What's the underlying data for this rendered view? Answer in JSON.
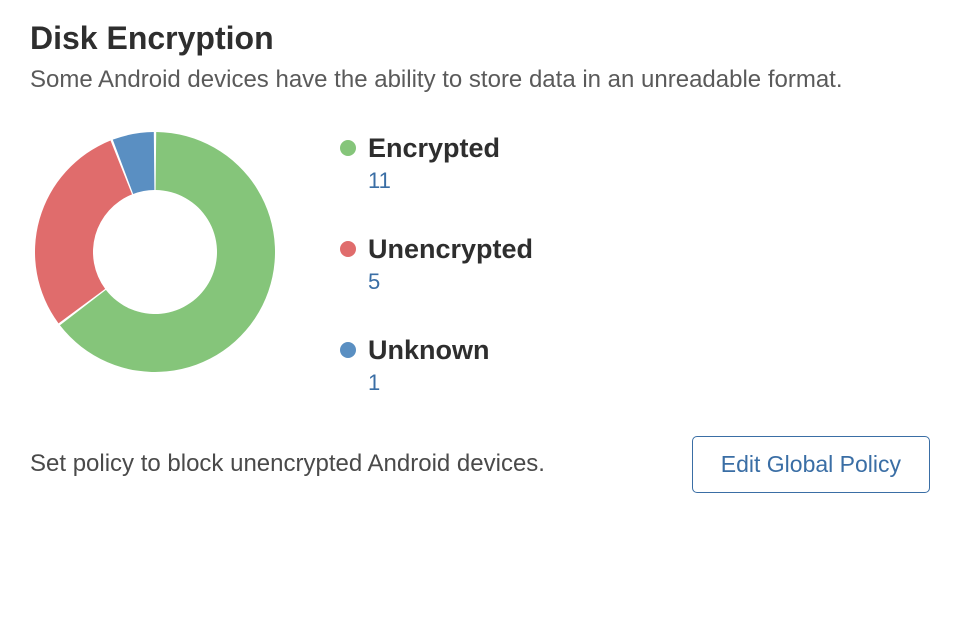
{
  "title": "Disk Encryption",
  "subtitle": "Some Android devices have the ability to store data in an unreadable format.",
  "legend": {
    "encrypted": {
      "label": "Encrypted",
      "value": "11",
      "color": "#85c57a"
    },
    "unencrypted": {
      "label": "Unencrypted",
      "value": "5",
      "color": "#e06c6c"
    },
    "unknown": {
      "label": "Unknown",
      "value": "1",
      "color": "#5a8fc2"
    }
  },
  "footer_text": "Set policy to block unencrypted Android devices.",
  "button_label": "Edit Global Policy",
  "chart_data": {
    "type": "pie",
    "title": "Disk Encryption",
    "series": [
      {
        "name": "Encrypted",
        "value": 11,
        "color": "#85c57a"
      },
      {
        "name": "Unencrypted",
        "value": 5,
        "color": "#e06c6c"
      },
      {
        "name": "Unknown",
        "value": 1,
        "color": "#5a8fc2"
      }
    ],
    "donut": true
  }
}
